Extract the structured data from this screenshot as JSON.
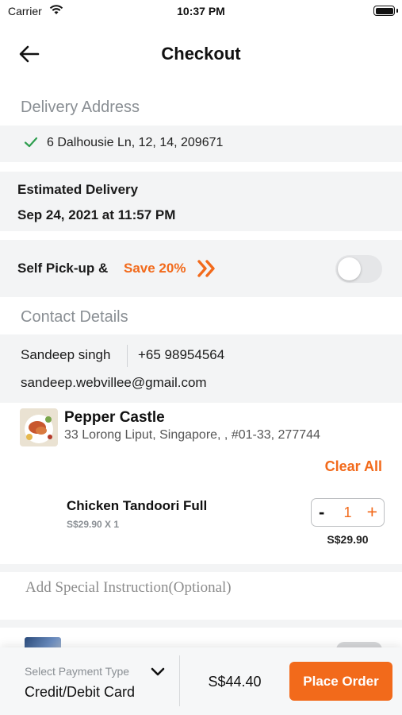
{
  "status_bar": {
    "carrier": "Carrier",
    "time": "10:37 PM",
    "icons": [
      "wifi-icon",
      "battery-icon"
    ]
  },
  "nav": {
    "title": "Checkout",
    "back_icon": "arrow-left-icon"
  },
  "delivery_address": {
    "header": "Delivery Address",
    "address": "6 Dalhousie Ln, 12, 14, 209671",
    "icon": "check-icon"
  },
  "estimated_delivery": {
    "label": "Estimated Delivery",
    "value": "Sep 24, 2021 at 11:57 PM"
  },
  "self_pickup": {
    "label": "Self Pick-up &",
    "promo": "Save 20%",
    "promo_icon": "double-chevron-right-icon",
    "enabled": false
  },
  "contact_details": {
    "header": "Contact Details",
    "name": "Sandeep singh",
    "phone": "+65 98954564",
    "email": "sandeep.webvillee@gmail.com"
  },
  "restaurant": {
    "name": "Pepper Castle",
    "address": "33 Lorong Liput, Singapore, , #01-33, 277744",
    "clear_all": "Clear All"
  },
  "cart_items": [
    {
      "name": "Chicken Tandoori Full",
      "unit_line": "S$29.90 X 1",
      "quantity": "1",
      "minus": "-",
      "plus": "+",
      "line_total": "S$29.90"
    }
  ],
  "special_instruction": {
    "placeholder": "Add Special Instruction(Optional)"
  },
  "bottom_bar": {
    "payment_label": "Select Payment Type",
    "payment_value": "Credit/Debit Card",
    "total": "S$44.40",
    "place_order": "Place Order"
  },
  "colors": {
    "accent": "#f26a1b",
    "check": "#2e9e4f",
    "section_bg": "#f3f4f5",
    "muted_text": "#8a8f94"
  }
}
